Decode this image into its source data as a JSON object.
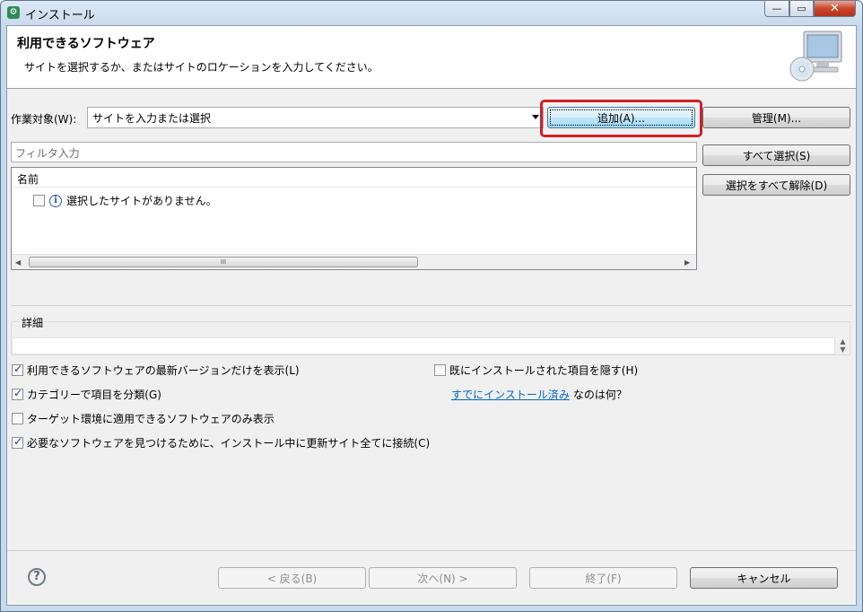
{
  "window": {
    "title": "インストール",
    "app_icon_glyph": "⚙",
    "controls": {
      "minimize": "—",
      "maximize": "▭",
      "close": "✕"
    }
  },
  "banner": {
    "title": "利用できるソフトウェア",
    "description": "サイトを選択するか、またはサイトのロケーションを入力してください。",
    "icon": "computer-cd-icon"
  },
  "work_with": {
    "label": "作業対象(W):",
    "value": "サイトを入力または選択",
    "add_button": "追加(A)...",
    "manage_button": "管理(M)..."
  },
  "filter": {
    "placeholder": "フィルタ入力"
  },
  "select_all_button": "すべて選択(S)",
  "deselect_all_button": "選択をすべて解除(D)",
  "tree": {
    "column_header": "名前",
    "rows": [
      {
        "text": "選択したサイトがありません。",
        "checked": false,
        "icon": "info-icon"
      }
    ],
    "scroll_left": "◀",
    "scroll_right": "▶",
    "scroll_thumb": "III"
  },
  "details": {
    "label": "詳細",
    "scroll_up": "▲",
    "scroll_down": "▼"
  },
  "options": {
    "latest_only": {
      "label": "利用できるソフトウェアの最新バージョンだけを表示(L)",
      "checked": true
    },
    "hide_installed": {
      "label": "既にインストールされた項目を隠す(H)",
      "checked": false
    },
    "group_by_category": {
      "label": "カテゴリーで項目を分類(G)",
      "checked": true
    },
    "what_installed_link": "すでにインストール済み",
    "what_installed_suffix": "なのは何？",
    "target_env_only": {
      "label": "ターゲット環境に適用できるソフトウェアのみ表示",
      "checked": false
    },
    "contact_all_sites": {
      "label": "必要なソフトウェアを見つけるために、インストール中に更新サイト全てに接続(C)",
      "checked": true
    }
  },
  "footer": {
    "help": "?",
    "back": "< 戻る(B)",
    "next": "次へ(N) >",
    "finish": "終了(F)",
    "cancel": "キャンセル"
  }
}
